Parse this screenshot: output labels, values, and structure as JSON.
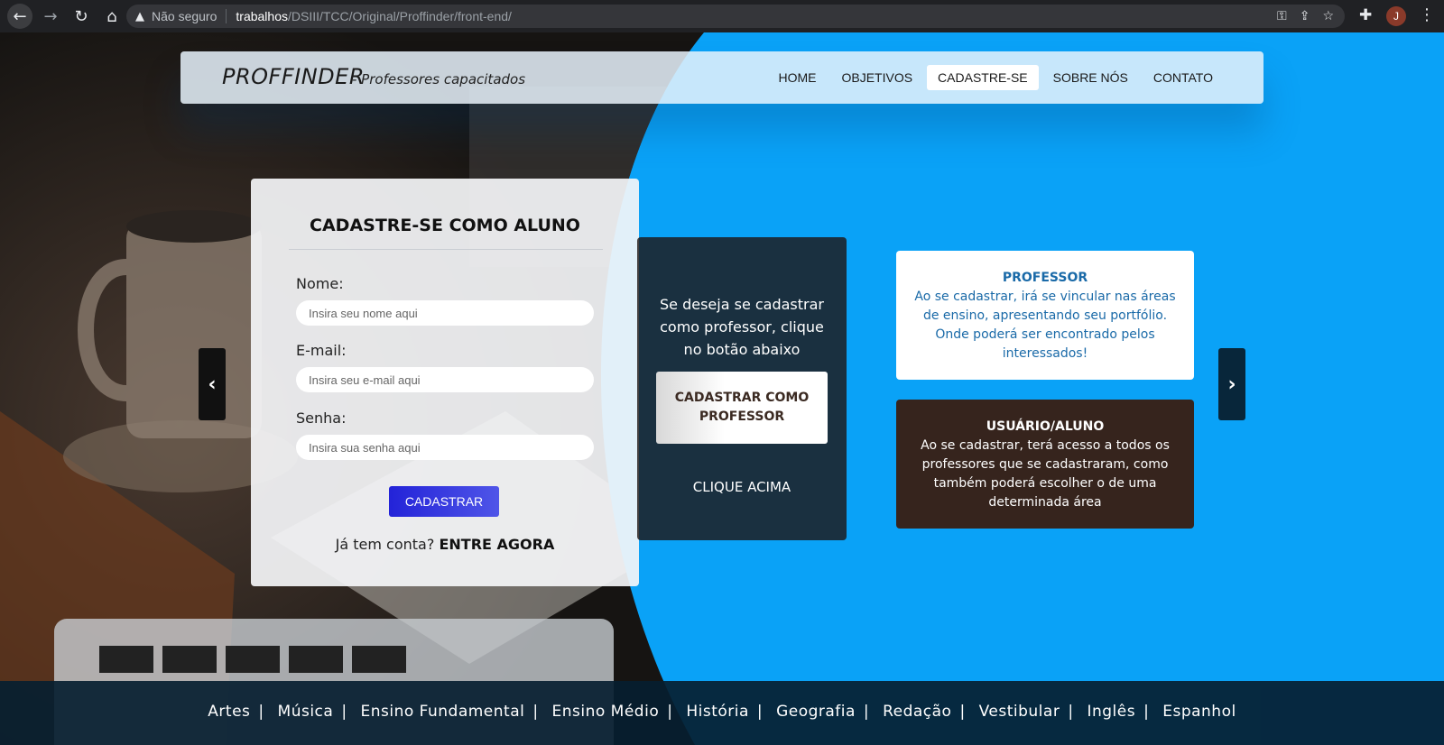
{
  "browser": {
    "security_label": "Não seguro",
    "url_host": "trabalhos",
    "url_path": "/DSIII/TCC/Original/Proffinder/front-end/",
    "profile_initial": "J"
  },
  "header": {
    "brand": "PROFFINDER",
    "tagline": "- Professores capacitados",
    "menu": [
      "HOME",
      "OBJETIVOS",
      "CADASTRE-SE",
      "SOBRE NÓS",
      "CONTATO"
    ],
    "active_menu": "CADASTRE-SE"
  },
  "form": {
    "title": "CADASTRE-SE COMO ALUNO",
    "name_label": "Nome:",
    "name_placeholder": "Insira seu nome aqui",
    "email_label": "E-mail:",
    "email_placeholder": "Insira seu e-mail aqui",
    "password_label": "Senha:",
    "password_placeholder": "Insira sua senha aqui",
    "submit_label": "CADASTRAR",
    "login_prompt": "Já tem conta?",
    "login_link": "ENTRE AGORA"
  },
  "teacher_panel": {
    "text": "Se deseja se cadastrar como professor, clique no botão abaixo",
    "button_label": "CADASTRAR COMO PROFESSOR",
    "hint": "CLIQUE ACIMA"
  },
  "info": {
    "teacher_title": "PROFESSOR",
    "teacher_text": "Ao se cadastrar, irá se vincular nas áreas de ensino, apresentando seu portfólio. Onde poderá ser encontrado pelos interessados!",
    "student_title": "USUÁRIO/ALUNO",
    "student_text": "Ao se cadastrar, terá acesso a todos os professores que se cadastraram, como também poderá escolher o de uma determinada área"
  },
  "footer": {
    "subjects": [
      "Artes",
      "Música",
      "Ensino Fundamental",
      "Ensino Médio",
      "História",
      "Geografia",
      "Redação",
      "Vestibular",
      "Inglês",
      "Espanhol"
    ]
  },
  "colors": {
    "accent_blue": "#0aa2f7",
    "submit_blue": "#2323d8",
    "teacher_text": "#1a6aa8",
    "student_card": "#36241d"
  }
}
